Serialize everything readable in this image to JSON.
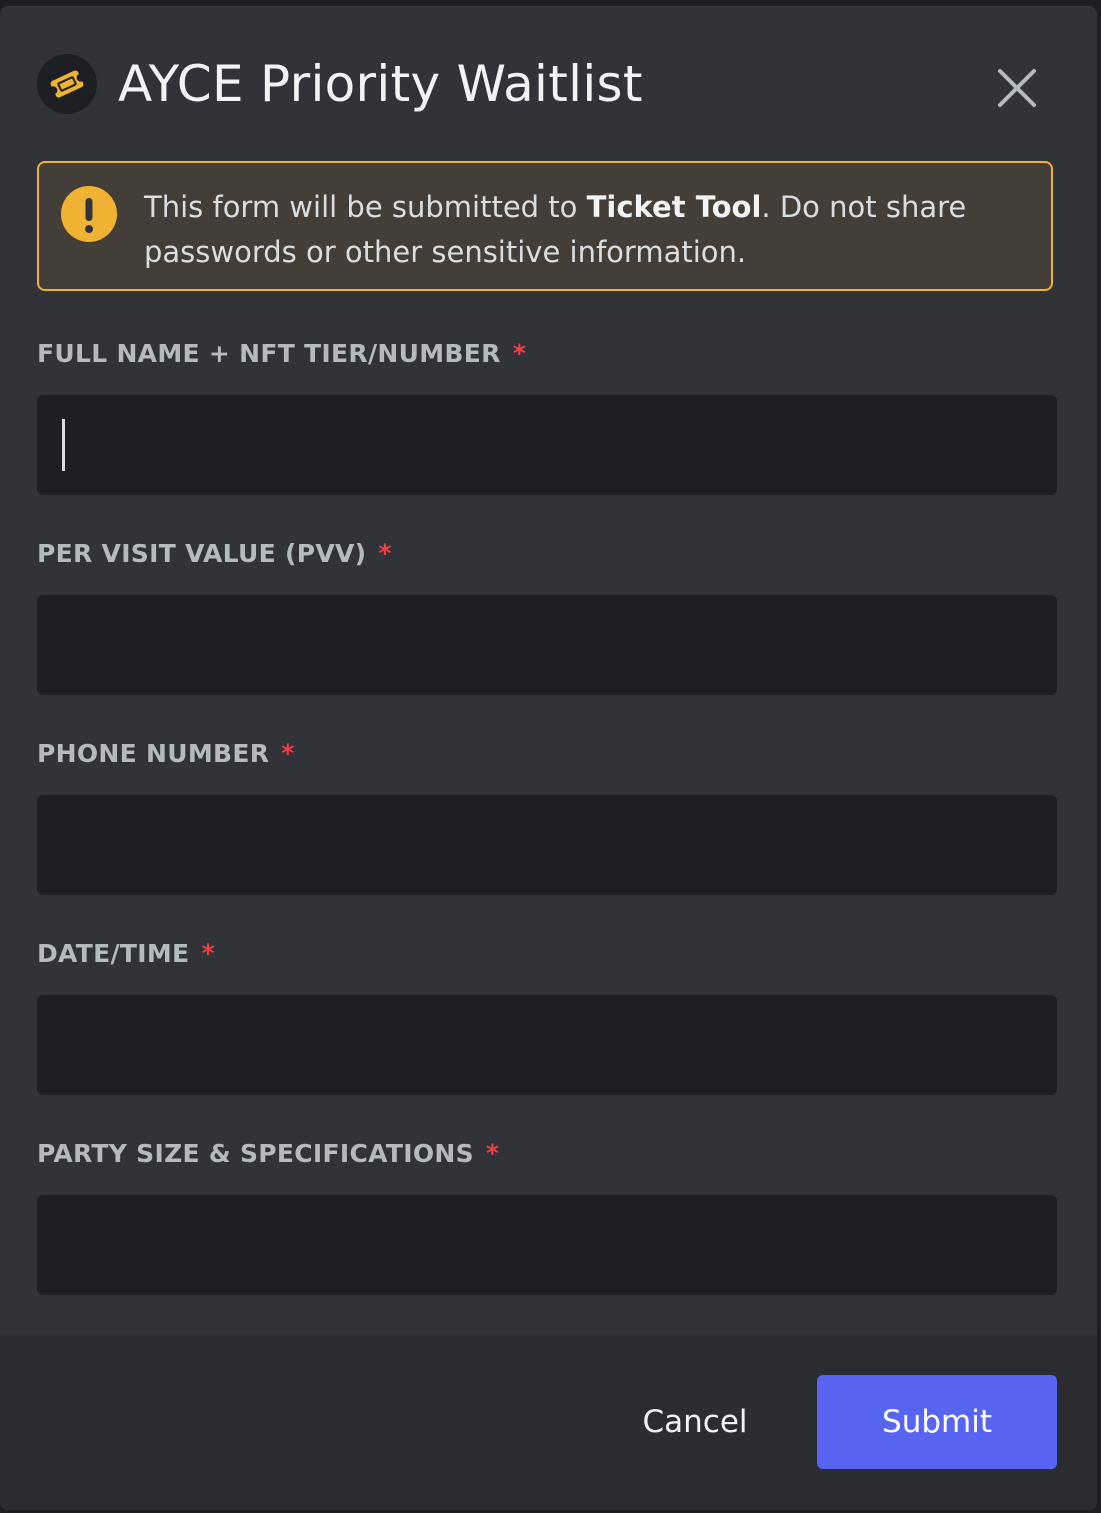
{
  "modal": {
    "title": "AYCE Priority Waitlist",
    "app_icon": "ticket-icon",
    "close_icon": "close-icon"
  },
  "warning": {
    "icon": "exclamation-circle-icon",
    "text_before": "This form will be submitted to ",
    "app_name": "Ticket Tool",
    "text_after": ". Do not share passwords or other sensitive information."
  },
  "fields": [
    {
      "label": "FULL NAME + NFT TIER/NUMBER",
      "required_mark": "*",
      "value": ""
    },
    {
      "label": "PER VISIT VALUE (PVV)",
      "required_mark": "*",
      "value": ""
    },
    {
      "label": "PHONE NUMBER",
      "required_mark": "*",
      "value": ""
    },
    {
      "label": "DATE/TIME",
      "required_mark": "*",
      "value": ""
    },
    {
      "label": "PARTY SIZE & SPECIFICATIONS",
      "required_mark": "*",
      "value": ""
    }
  ],
  "footer": {
    "cancel_label": "Cancel",
    "submit_label": "Submit"
  },
  "colors": {
    "modal_bg": "#313338",
    "footer_bg": "#2b2d31",
    "input_bg": "#1e1f22",
    "warning_border": "#f0b232",
    "warning_bg": "#433f38",
    "required": "#f23f42",
    "submit_bg": "#5865f2"
  }
}
